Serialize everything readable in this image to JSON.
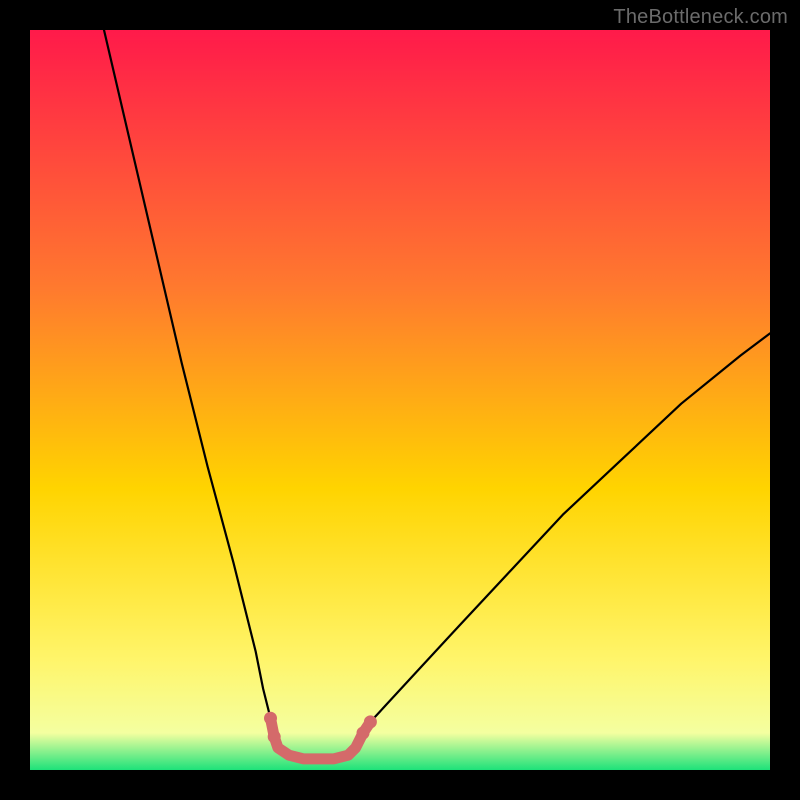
{
  "watermark": "TheBottleneck.com",
  "colors": {
    "frame_bg": "#000000",
    "gradient_top": "#ff1a4a",
    "gradient_mid1": "#ff7a2e",
    "gradient_mid2": "#ffd400",
    "gradient_low": "#fff56a",
    "gradient_pale": "#f4ffa0",
    "gradient_green": "#1de27a",
    "curve": "#000000",
    "marker": "#d46a6a"
  },
  "chart_data": {
    "type": "line",
    "title": "",
    "xlabel": "",
    "ylabel": "",
    "xlim": [
      0,
      100
    ],
    "ylim": [
      0,
      100
    ],
    "series": [
      {
        "name": "bottleneck-curve",
        "x": [
          10,
          13.5,
          17,
          20.5,
          24,
          27.5,
          29,
          30.5,
          31.5,
          32.5,
          33.5,
          35,
          37,
          39,
          41,
          43,
          44.5,
          46,
          52,
          58,
          65,
          72,
          80,
          88,
          96,
          100
        ],
        "y": [
          100,
          85,
          70,
          55,
          41,
          28,
          22,
          16,
          11,
          7,
          4,
          2,
          1,
          1,
          1,
          2,
          4,
          6.5,
          13,
          19.5,
          27,
          34.5,
          42,
          49.5,
          56,
          59
        ]
      },
      {
        "name": "marker-band",
        "x": [
          32.5,
          33,
          33.5,
          35,
          37,
          39,
          41,
          43,
          44,
          44.5,
          45,
          46
        ],
        "y": [
          7,
          4.5,
          3,
          2,
          1.5,
          1.5,
          1.5,
          2,
          3,
          4,
          5,
          6.5
        ]
      }
    ],
    "annotations": []
  }
}
